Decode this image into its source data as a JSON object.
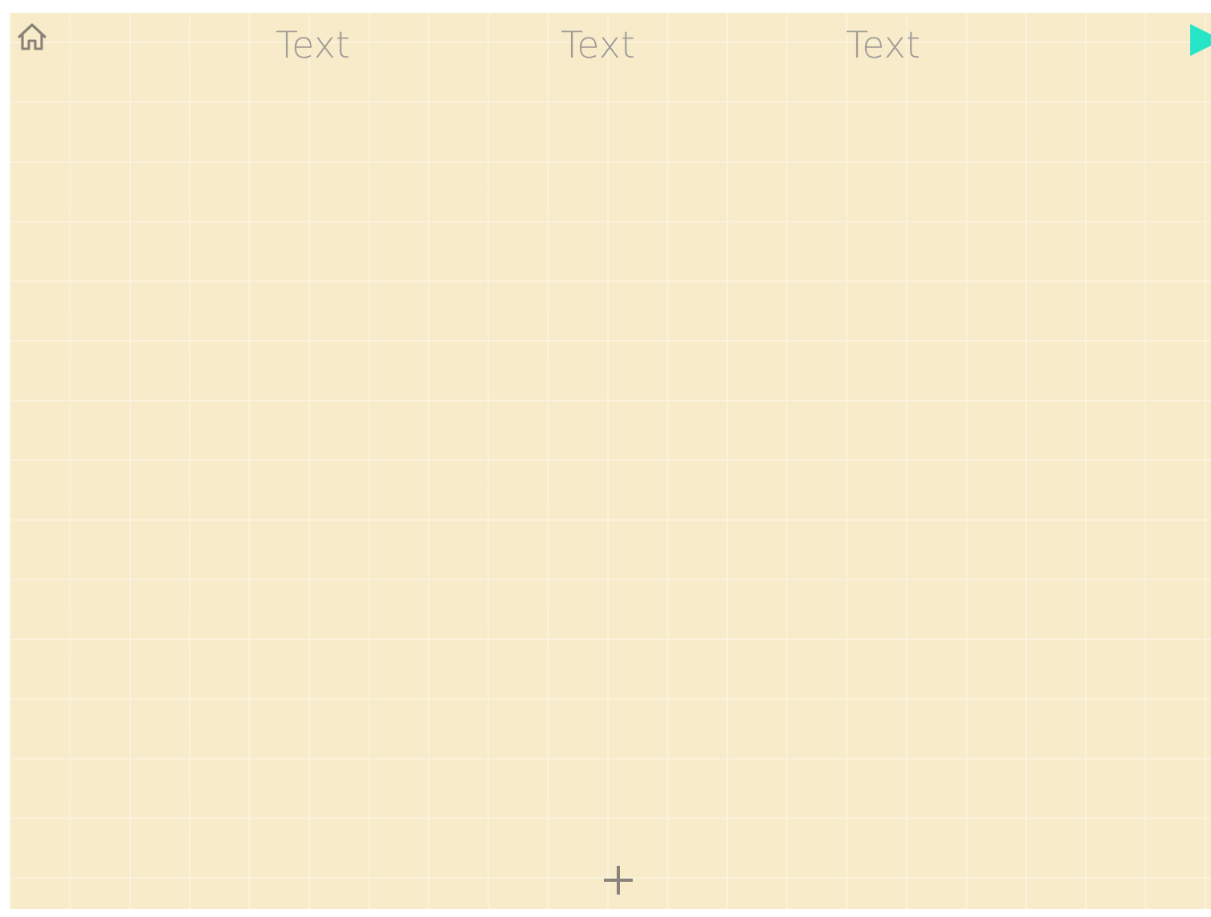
{
  "headers": [
    {
      "label": "Text"
    },
    {
      "label": "Text"
    },
    {
      "label": "Text"
    }
  ]
}
